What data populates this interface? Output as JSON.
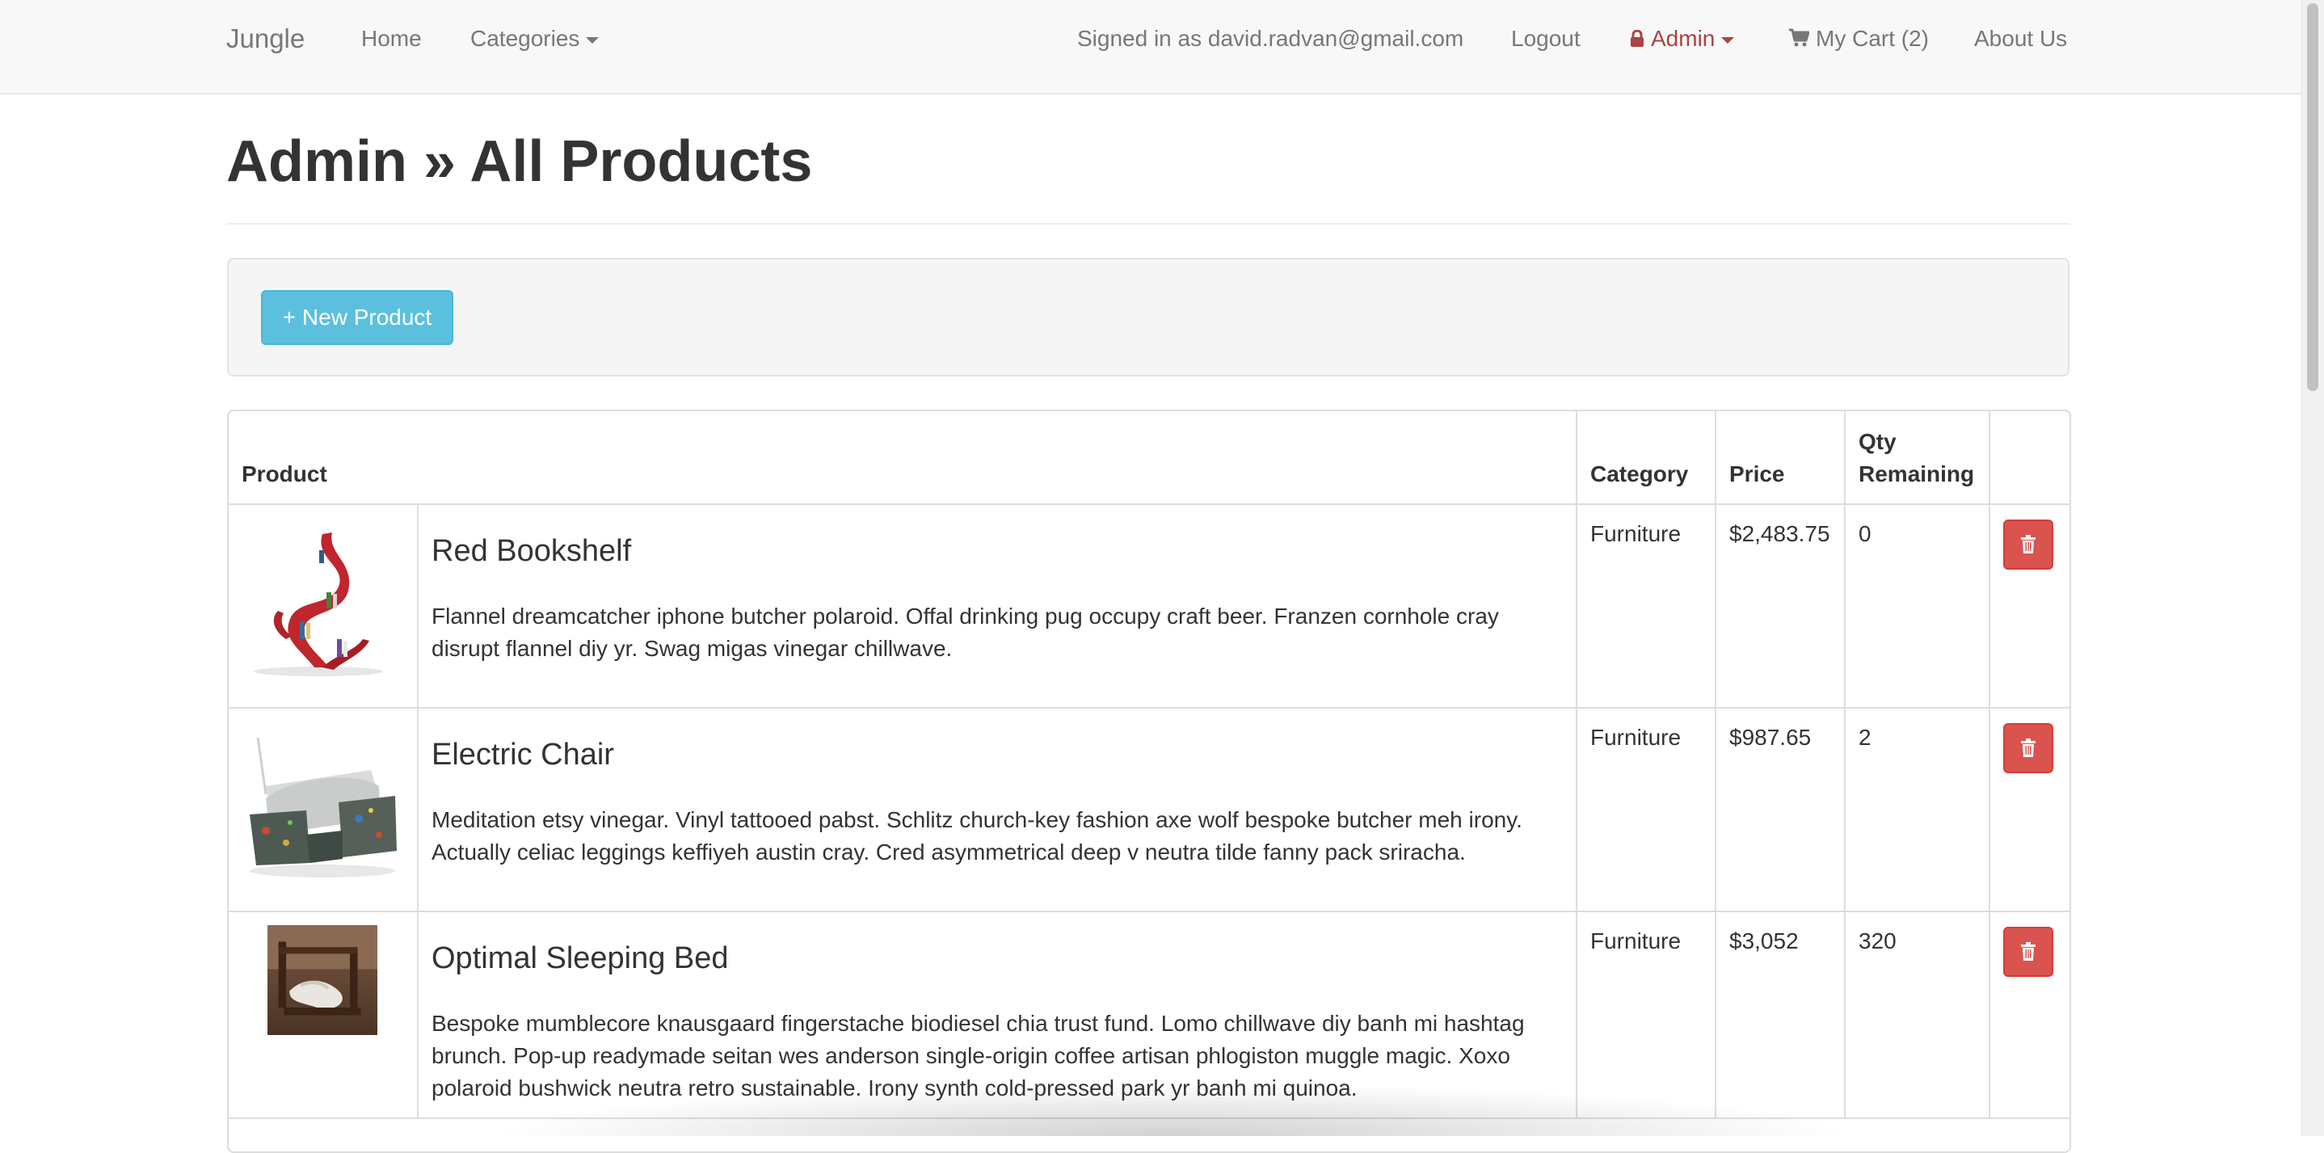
{
  "navbar": {
    "brand": "Jungle",
    "home": "Home",
    "categories": "Categories",
    "signed_in": "Signed in as david.radvan@gmail.com",
    "logout": "Logout",
    "admin": "Admin",
    "cart": "My Cart (2)",
    "about": "About Us"
  },
  "page": {
    "title": "Admin » All Products"
  },
  "actions": {
    "new_product": "+ New Product"
  },
  "table": {
    "headers": {
      "product": "Product",
      "category": "Category",
      "price": "Price",
      "qty": "Qty Remaining"
    },
    "rows": [
      {
        "name": "Red Bookshelf",
        "description": "Flannel dreamcatcher iphone butcher polaroid. Offal drinking pug occupy craft beer. Franzen cornhole cray disrupt flannel diy yr. Swag migas vinegar chillwave.",
        "category": "Furniture",
        "price": "$2,483.75",
        "qty": "0"
      },
      {
        "name": "Electric Chair",
        "description": "Meditation etsy vinegar. Vinyl tattooed pabst. Schlitz church-key fashion axe wolf bespoke butcher meh irony. Actually celiac leggings keffiyeh austin cray. Cred asymmetrical deep v neutra tilde fanny pack sriracha.",
        "category": "Furniture",
        "price": "$987.65",
        "qty": "2"
      },
      {
        "name": "Optimal Sleeping Bed",
        "description": "Bespoke mumblecore knausgaard fingerstache biodiesel chia trust fund. Lomo chillwave diy banh mi hashtag brunch. Pop-up readymade seitan wes anderson single-origin coffee artisan phlogiston muggle magic. Xoxo polaroid bushwick neutra retro sustainable. Irony synth cold-pressed park yr banh mi quinoa.",
        "category": "Furniture",
        "price": "$3,052",
        "qty": "320"
      }
    ]
  },
  "colors": {
    "navbar_bg": "#f8f8f8",
    "nav_text": "#777777",
    "admin_accent": "#a94442",
    "info_button": "#5bc0de",
    "danger_button": "#d9534f"
  },
  "icons": [
    "lock-icon",
    "caret-down-icon",
    "shopping-cart-icon",
    "trash-icon"
  ]
}
